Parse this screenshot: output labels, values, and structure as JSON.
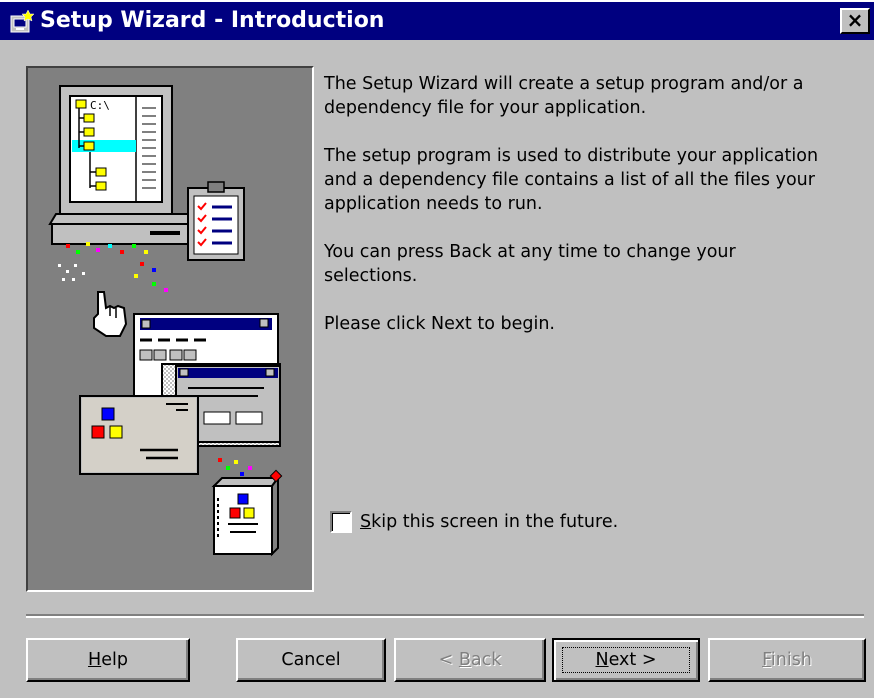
{
  "window": {
    "title": "Setup Wizard - Introduction",
    "close_label": "×"
  },
  "illustration": {
    "drive_label": "C:\\"
  },
  "intro": {
    "paragraphs": [
      "The Setup Wizard will create a setup program and/or a\ndependency file for your application.",
      "The setup program is used to distribute your application\nand a dependency file contains a list of all the files your\napplication needs to run.",
      "You can press Back at any time to change your\nselections.",
      "Please click Next to begin."
    ]
  },
  "skip": {
    "checked": false,
    "label_prefix": "",
    "label_mnemonic": "S",
    "label_rest": "kip this screen in the future."
  },
  "buttons": {
    "help": {
      "mnemonic": "H",
      "rest": "elp",
      "enabled": true
    },
    "cancel": {
      "label": "Cancel",
      "enabled": true
    },
    "back": {
      "prefix": "< ",
      "mnemonic": "B",
      "rest": "ack",
      "enabled": false
    },
    "next": {
      "mnemonic": "N",
      "rest": "ext >",
      "enabled": true,
      "default": true
    },
    "finish": {
      "mnemonic": "F",
      "rest": "inish",
      "enabled": false
    }
  },
  "colors": {
    "titlebar": "#000080",
    "face": "#c0c0c0",
    "art_background": "#808080",
    "highlight": "#00ffff",
    "disabled_text": "#808080"
  },
  "icons": {
    "title": "setup-wizard-icon",
    "close": "close-icon",
    "checkbox": "checkbox-icon"
  }
}
